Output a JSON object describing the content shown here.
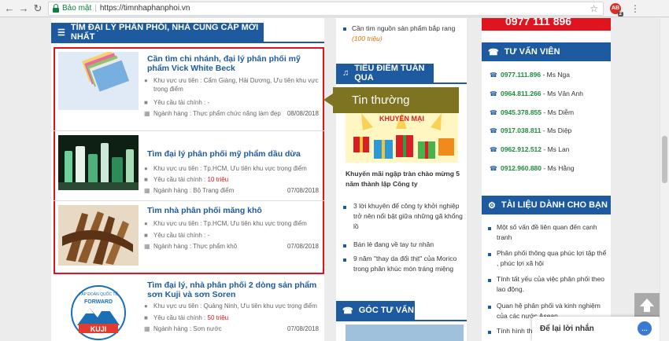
{
  "browser": {
    "secure_label": "Bảo mật",
    "separator": "|",
    "url": "https://timnhaphanphoi.vn",
    "ext_badge": "2"
  },
  "left": {
    "heading": "TÌM ĐẠI LÝ PHÂN PHỐI, NHÀ CUNG CẤP MỚI NHẤT",
    "items": [
      {
        "title": "Cần tìm chi nhánh, đại lý phân phối mỹ phẩm Vick White Beck",
        "area": "Khu vực ưu tiên : Cẩm Giàng, Hải Dương, Ưu tiên khu vực trọng điểm",
        "finance_label": "Yêu cầu tài chính :",
        "finance_value": "-",
        "industry": "Ngành hàng : Thực phẩm chức năng làm đẹp",
        "date": "08/08/2018"
      },
      {
        "title": "Tìm đại lý phân phối mỹ phẩm dầu dừa",
        "area": "Khu vực ưu tiên : Tp.HCM, Ưu tiên khu vực trọng điểm",
        "finance_label": "Yêu cầu tài chính :",
        "finance_value": "10 triệu",
        "industry": "Ngành hàng : Bộ Trang điểm",
        "date": "07/08/2018"
      },
      {
        "title": "Tìm nhà phân phối măng khô",
        "area": "Khu vực ưu tiên : Tp.HCM, Ưu tiên khu vực trọng điểm",
        "finance_label": "Yêu cầu tài chính :",
        "finance_value": "-",
        "industry": "Ngành hàng : Thực phẩm khô",
        "date": "07/08/2018"
      },
      {
        "title": "Tìm đại lý, nhà phân phối 2 dòng sản phẩm sơn Kuji và sơn Soren",
        "area": "Khu vực ưu tiên : Quảng Ninh, Ưu tiên khu vực trọng điểm",
        "finance_label": "Yêu cầu tài chính :",
        "finance_value": "50 triệu",
        "industry": "Ngành hàng : Sơn nước",
        "date": "07/08/2018",
        "logo_top": "TẬP ĐOÀN QUỐC TẾ",
        "logo_mid": "FORWARD",
        "logo_brand": "KUJI"
      }
    ]
  },
  "middle": {
    "top_item": "Cần tìm nguồn sản phẩm bắp rang",
    "top_item_tag": "(100 triệu)",
    "spotlight_heading": "TIÊU ĐIỂM TUẦN QUA",
    "tooltip": "Tin thường",
    "promo_banner": "KHUYẾN MẠI",
    "feature_title": "Khuyến mãi ngập tràn chào mừng 5 năm thành lập Công ty",
    "news": [
      "3 lời khuyên để công ty khởi nghiệp trở nên nổi bật giữa những gã khổng lồ",
      "Bán lẻ đang về tay tư nhân",
      "9 năm \"thay da đổi thịt\" của Morico trong phân khúc món tráng miệng"
    ],
    "advice_heading": "GÓC TƯ VẤN"
  },
  "right": {
    "hotline_partial": "0977 111 896",
    "consult_heading": "TƯ VẤN VIÊN",
    "consultants": [
      {
        "phone": "0977.111.896",
        "name": "- Ms Nga"
      },
      {
        "phone": "0964.811.266",
        "name": "- Ms Vân Anh"
      },
      {
        "phone": "0945.378.855",
        "name": "- Ms Diễm"
      },
      {
        "phone": "0917.038.811",
        "name": "- Ms Diệp"
      },
      {
        "phone": "0962.912.512",
        "name": "- Ms Lan"
      },
      {
        "phone": "0912.960.880",
        "name": "- Ms Hằng"
      }
    ],
    "docs_heading": "TÀI LIỆU DÀNH CHO BẠN",
    "docs": [
      "Một số vấn đề liên quan đến cạnh tranh",
      "Phân phối thông qua phúc lợi tập thể , phúc lợi xã hội",
      "Tính tất yếu của việc phân phối theo lao động.",
      "Quan hệ phân phối và kinh nghiệm của các nước Asean",
      "Tính hình th"
    ]
  },
  "chat": {
    "label": "Để lại lời nhắn"
  },
  "colors": {
    "brand_blue": "#1e5aa0",
    "highlight_red": "#e0141e",
    "phone_green": "#1e8a3c",
    "tooltip_olive": "#7d7320"
  }
}
